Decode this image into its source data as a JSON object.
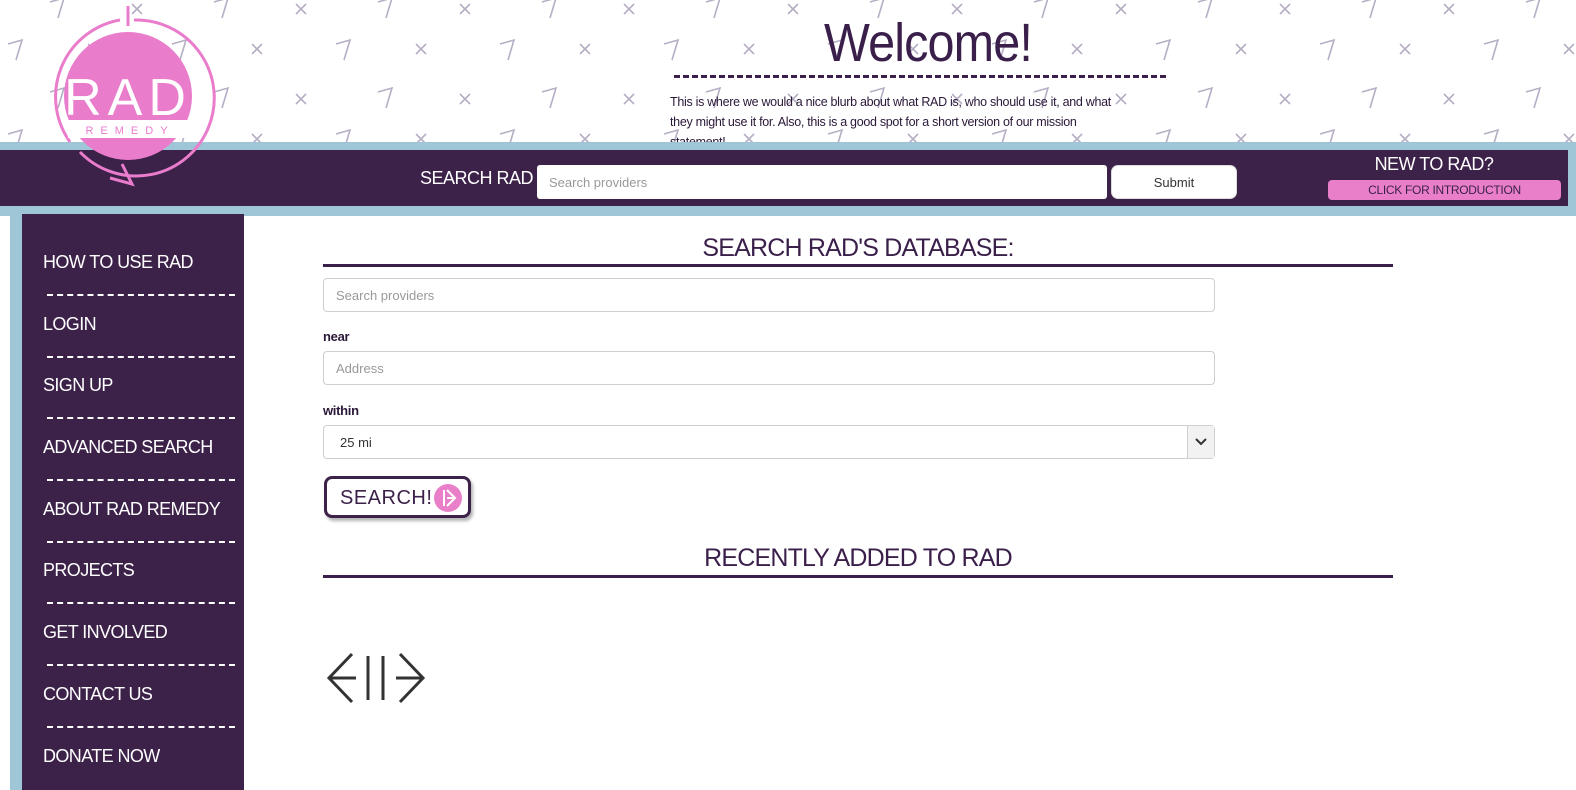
{
  "logo": {
    "main_text": "RAD",
    "sub_text": "REMEDY"
  },
  "header": {
    "welcome": "Welcome!",
    "blurb": "This is where we would a nice blurb about what RAD is, who should use it, and what they might use it for. Also, this is a good spot for a short version of our mission statement!"
  },
  "navbar": {
    "search_label": "SEARCH RAD",
    "search_placeholder": "Search providers",
    "submit_label": "Submit",
    "new_to_rad": "NEW TO RAD?",
    "intro_label": "CLICK FOR INTRODUCTION"
  },
  "sidebar": {
    "items": [
      {
        "label": "HOW TO USE RAD"
      },
      {
        "label": "LOGIN"
      },
      {
        "label": "SIGN UP"
      },
      {
        "label": "ADVANCED SEARCH"
      },
      {
        "label": "ABOUT RAD REMEDY"
      },
      {
        "label": "PROJECTS"
      },
      {
        "label": "GET INVOLVED"
      },
      {
        "label": "CONTACT US"
      },
      {
        "label": "DONATE NOW"
      }
    ]
  },
  "search_form": {
    "title": "SEARCH RAD'S DATABASE:",
    "providers_placeholder": "Search providers",
    "near_label": "near",
    "address_placeholder": "Address",
    "within_label": "within",
    "within_value": "25 mi",
    "search_button_label": "SEARCH!"
  },
  "recent": {
    "title": "RECENTLY ADDED TO RAD"
  },
  "colors": {
    "brand_purple": "#3c2149",
    "brand_pink": "#e97fc8",
    "accent_blue": "#9fc6d6"
  }
}
